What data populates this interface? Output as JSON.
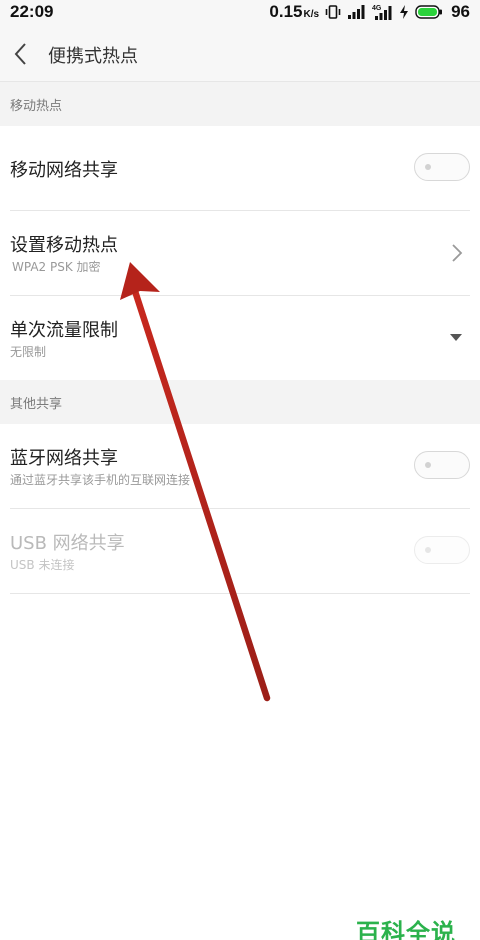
{
  "status_bar": {
    "time": "22:09",
    "net_speed": "0.15",
    "net_speed_unit": "K/s",
    "battery": "96",
    "network_type": "4G",
    "icons": [
      "vibrate-icon",
      "signal-icon",
      "signal-4g-icon",
      "charging-icon",
      "battery-icon"
    ]
  },
  "header": {
    "title": "便携式热点",
    "back_icon": "chevron-left-icon"
  },
  "sections": {
    "mobile_hotspot": {
      "title": "移动热点",
      "rows": {
        "share": {
          "label": "移动网络共享",
          "toggle_on": false
        },
        "setup": {
          "label": "设置移动热点",
          "sub": "WPA2 PSK 加密",
          "accessory": "chevron-right-icon"
        },
        "limit": {
          "label": "单次流量限制",
          "sub": "无限制",
          "accessory": "dropdown-arrow-icon"
        }
      }
    },
    "other_sharing": {
      "title": "其他共享",
      "rows": {
        "bluetooth": {
          "label": "蓝牙网络共享",
          "sub": "通过蓝牙共享该手机的互联网连接",
          "toggle_on": false
        },
        "usb": {
          "label": "USB 网络共享",
          "sub": "USB 未连接",
          "toggle_on": false,
          "disabled": true
        }
      }
    }
  },
  "annotation": {
    "type": "arrow",
    "color": "#b5231b",
    "target": "设置移动热点"
  },
  "watermark": {
    "text": "百科全说",
    "color": "#2bb24c"
  },
  "colors": {
    "background": "#ffffff",
    "section_background": "#f3f3f3",
    "divider": "#e6e6e6",
    "toggle_border": "#d8d8d8"
  }
}
